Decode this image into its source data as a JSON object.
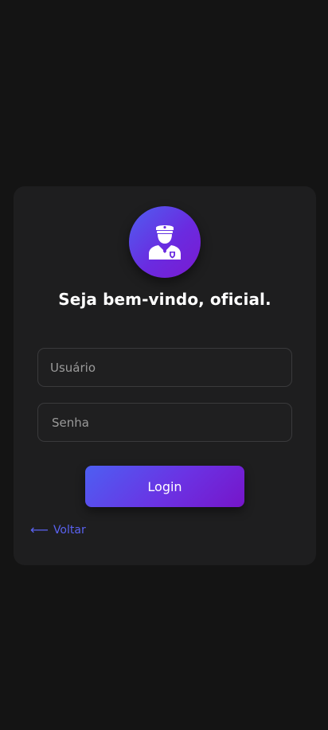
{
  "header": {
    "icon": "police-officer-icon",
    "title": "Seja bem-vindo, oficial."
  },
  "form": {
    "username_placeholder": "Usuário",
    "password_placeholder": "Senha",
    "login_label": "Login"
  },
  "footer": {
    "back_arrow": "⟵",
    "back_label": "Voltar"
  },
  "colors": {
    "background": "#141414",
    "card": "#1e1e1f",
    "accent_start": "#4d5ff2",
    "accent_end": "#7615c9",
    "link": "#5a62f0"
  }
}
